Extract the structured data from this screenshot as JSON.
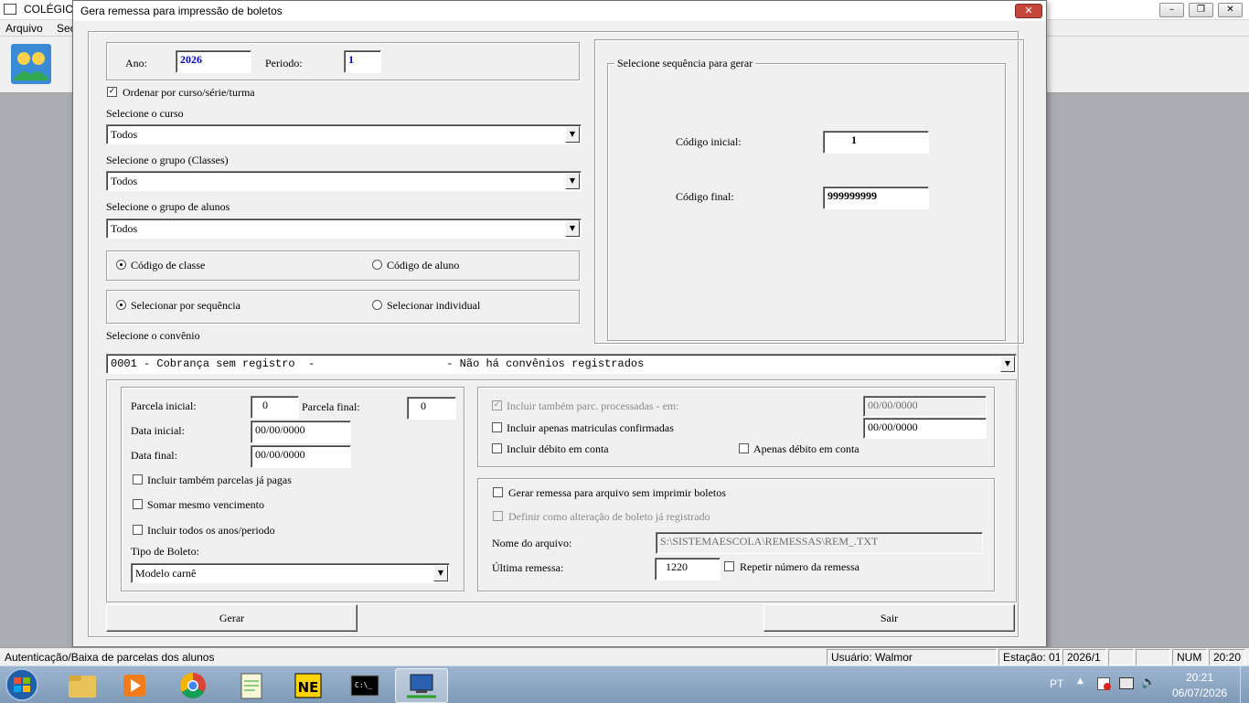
{
  "app": {
    "title": "COLÉGIO",
    "menu": [
      "Arquivo",
      "Sec"
    ]
  },
  "dialog": {
    "title": "Gera remessa para impressão de boletos",
    "close_glyph": "✕",
    "ano_label": "Ano:",
    "ano_value": "2026",
    "periodo_label": "Periodo:",
    "periodo_value": "1",
    "ordenar_label": "Ordenar por curso/série/turma",
    "ordenar_checked": true,
    "curso_label": "Selecione o curso",
    "curso_value": "Todos",
    "grupo_classes_label": "Selecione o grupo (Classes)",
    "grupo_classes_value": "Todos",
    "grupo_alunos_label": "Selecione o grupo de alunos",
    "grupo_alunos_value": "Todos",
    "codigo_classe_label": "Código de classe",
    "codigo_aluno_label": "Código de aluno",
    "codigo_selected": "classe",
    "sequencia_label": "Selecionar por sequência",
    "individual_label": "Selecionar individual",
    "selecao_selected": "sequencia",
    "sequencia_group_title": "Selecione sequência para gerar",
    "codigo_inicial_label": "Código inicial:",
    "codigo_inicial_value": "1",
    "codigo_final_label": "Código final:",
    "codigo_final_value": "999999999",
    "convenio_label": "Selecione o convênio",
    "convenio_value": "0001 - Cobrança sem registro  -                    - Não há convênios registrados",
    "parcela_inicial_label": "Parcela inicial:",
    "parcela_inicial_value": "0",
    "parcela_final_label": "Parcela final:",
    "parcela_final_value": "0",
    "data_inicial_label": "Data inicial:",
    "data_inicial_value": "00/00/0000",
    "data_final_label": "Data final:",
    "data_final_value": "00/00/0000",
    "incluir_pagas_label": "Incluir também parcelas já pagas",
    "somar_vencimento_label": "Somar mesmo vencimento",
    "incluir_anos_label": "Incluir todos os anos/periodo",
    "tipo_boleto_label": "Tipo de Boleto:",
    "tipo_boleto_value": "Modelo carnê",
    "incluir_processadas_label": "Incluir também parc. processadas - em:",
    "incluir_processadas_date": "00/00/0000",
    "apenas_confirmadas_label": "Incluir apenas matriculas confirmadas",
    "apenas_confirmadas_date": "00/00/0000",
    "incluir_debito_label": "Incluir débito em conta",
    "apenas_debito_label": "Apenas débito em conta",
    "gerar_arquivo_label": "Gerar remessa para arquivo sem imprimir boletos",
    "definir_alteracao_label": "Definir como alteração de boleto já registrado",
    "nome_arquivo_label": "Nome do arquivo:",
    "nome_arquivo_value": "S:\\SISTEMAESCOLA\\REMESSAS\\REM_.TXT",
    "ultima_remessa_label": "Última remessa:",
    "ultima_remessa_value": "1220",
    "repetir_label": "Repetir número da remessa",
    "gerar_button": "Gerar",
    "sair_button": "Sair"
  },
  "statusbar": {
    "message": "Autenticação/Baixa de parcelas dos alunos",
    "usuario": "Usuário: Walmor",
    "estacao": "Estação: 01",
    "periodo": "2026/1",
    "num": "NUM",
    "time": "20:20"
  },
  "taskbar": {
    "lang": "PT",
    "clock_time": "20:21",
    "clock_date": "06/07/2026",
    "items": [
      "explorer-icon",
      "media-player-icon",
      "chrome-icon",
      "notepad-icon",
      "nero-icon",
      "cmd-icon",
      "network-app-icon"
    ]
  },
  "colors": {
    "input_blue_text": "#0000c0",
    "close_red": "#c7463a"
  }
}
